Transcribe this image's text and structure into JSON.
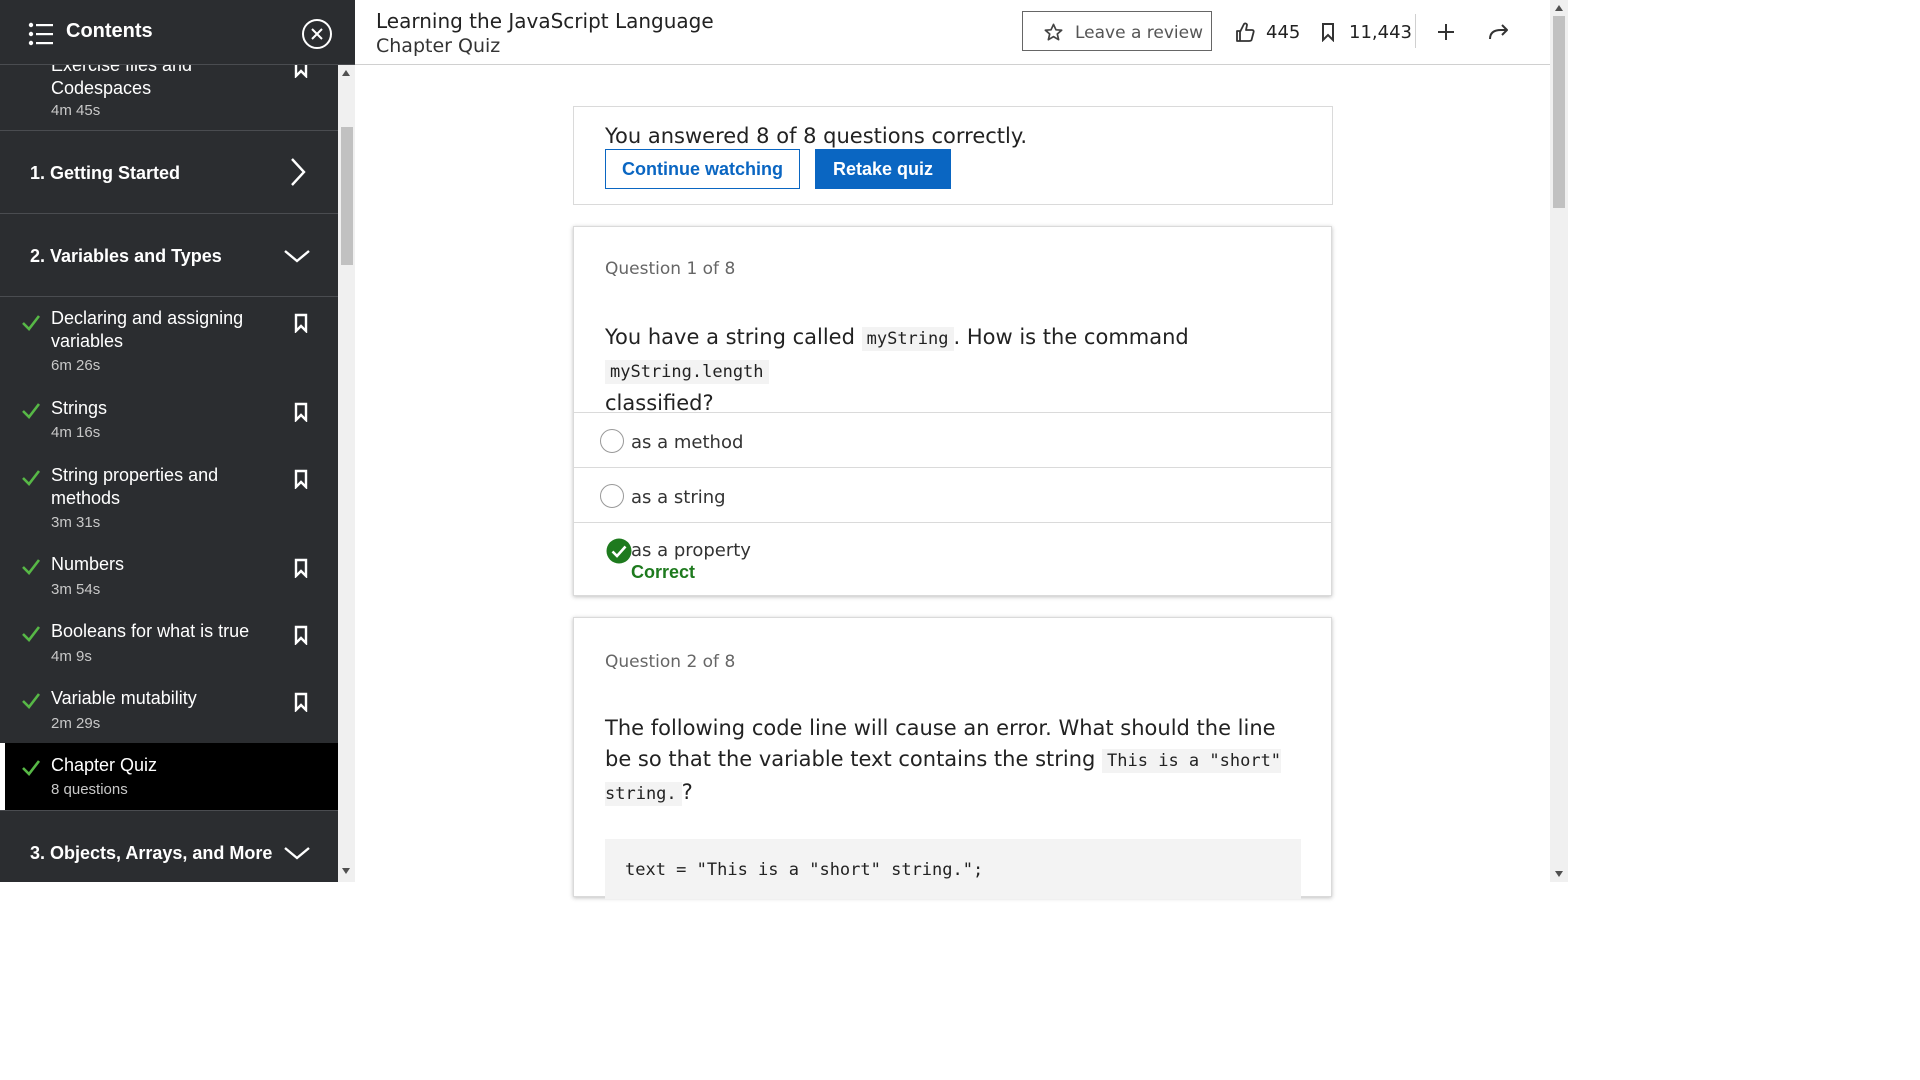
{
  "sidebar": {
    "title": "Contents",
    "partial_item": {
      "title_line1": "Exercise files and",
      "title_line2": "Codespaces",
      "duration": "4m 45s"
    },
    "chapters": [
      {
        "title": "1. Getting Started",
        "state": "collapsed"
      },
      {
        "title": "2. Variables and Types",
        "state": "expanded"
      },
      {
        "title": "3. Objects, Arrays, and More",
        "state": "expanded"
      }
    ],
    "lessons": [
      {
        "title": "Declaring and assigning variables",
        "duration": "6m 26s",
        "completed": true
      },
      {
        "title": "Strings",
        "duration": "4m 16s",
        "completed": true
      },
      {
        "title": "String properties and methods",
        "duration": "3m 31s",
        "completed": true
      },
      {
        "title": "Numbers",
        "duration": "3m 54s",
        "completed": true
      },
      {
        "title": "Booleans for what is true",
        "duration": "4m 9s",
        "completed": true
      },
      {
        "title": "Variable mutability",
        "duration": "2m 29s",
        "completed": true
      },
      {
        "title": "Chapter Quiz",
        "duration": "8 questions",
        "completed": true,
        "active": true
      }
    ]
  },
  "header": {
    "course_title": "Learning the JavaScript Language",
    "subtitle": "Chapter Quiz",
    "review_label": "Leave a review",
    "likes": "445",
    "saves": "11,443"
  },
  "result": {
    "text": "You answered 8 of 8 questions correctly.",
    "continue_label": "Continue watching",
    "retake_label": "Retake quiz"
  },
  "questions": [
    {
      "number": "Question 1 of 8",
      "text_part1": "You have a string called",
      "code1": "myString",
      "text_part2": ". How is the command",
      "code2": "myString.length",
      "text_part3": "classified?",
      "options": [
        "as a method",
        "as a string",
        "as a property"
      ],
      "correct_index": 2,
      "feedback": "Correct"
    },
    {
      "number": "Question 2 of 8",
      "text_part1": "The following code line will cause an error. What should the line be so that the variable text contains the string",
      "code1": "This is a \"short\" string.",
      "text_part2": "?",
      "code_block": "text = \"This is a \"short\" string.\";"
    }
  ],
  "colors": {
    "sidebar_bg": "#2b2d30",
    "accent": "#0a66c2",
    "check_green": "#57b846",
    "correct_green": "#1e7a1e"
  }
}
